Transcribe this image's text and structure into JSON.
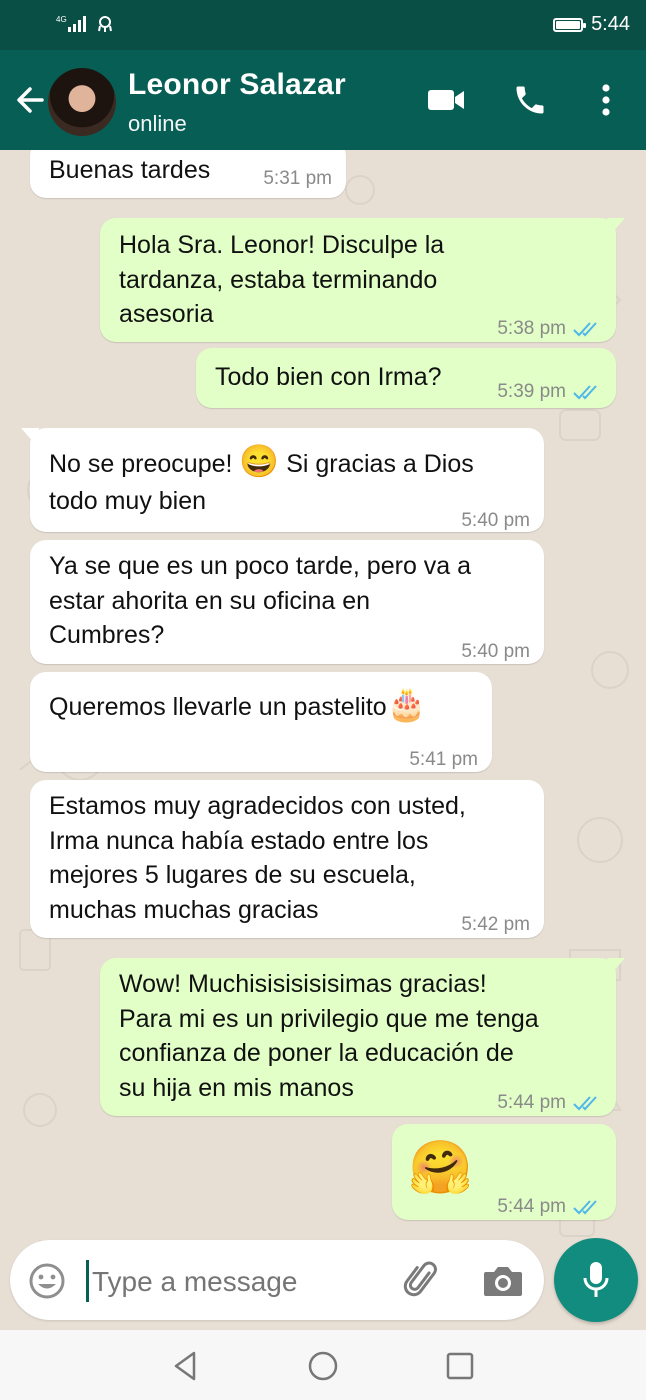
{
  "status_bar": {
    "network": "4G",
    "time": "5:44"
  },
  "header": {
    "contact_name": "Leonor Salazar",
    "status": "online"
  },
  "messages": [
    {
      "dir": "in",
      "lines": "Buenas tardes",
      "time": "5:31 pm"
    },
    {
      "dir": "out",
      "lines": "Hola Sra. Leonor! Disculpe la\ntardanza, estaba terminando\nasesoria",
      "time": "5:38 pm",
      "read": true
    },
    {
      "dir": "out",
      "lines": "Todo bien con Irma?",
      "time": "5:39 pm",
      "read": true
    },
    {
      "dir": "in",
      "lines_a": "No se preocupe! ",
      "emoji": "😄",
      "lines_b": " Si gracias a Dios",
      "lines_c": "todo muy bien",
      "time": "5:40 pm"
    },
    {
      "dir": "in",
      "lines": "Ya se que es un poco tarde, pero va a\nestar ahorita en su oficina en\nCumbres?",
      "time": "5:40 pm"
    },
    {
      "dir": "in",
      "lines": "Queremos llevarle un pastelito",
      "emoji": "🎂",
      "time": "5:41 pm"
    },
    {
      "dir": "in",
      "lines": "Estamos muy agradecidos con usted,\nIrma nunca había estado entre los\nmejores 5 lugares de su escuela,\nmuchas muchas gracias",
      "time": "5:42 pm"
    },
    {
      "dir": "out",
      "lines": "Wow! Muchisisisisisimas gracias!\nPara mi es un privilegio que me tenga\nconfianza de poner la educación de\nsu hija en mis manos",
      "time": "5:44 pm",
      "read": true
    },
    {
      "dir": "out",
      "emoji": "🤗",
      "time": "5:44 pm",
      "read": true
    }
  ],
  "composer": {
    "placeholder": "Type a message"
  },
  "colors": {
    "header": "#075e54",
    "status_bar": "#0a4f46",
    "outgoing": "#e1ffc7",
    "incoming": "#ffffff",
    "read_ticks": "#4fb6ec",
    "fab": "#128c7e"
  },
  "icons": [
    "back-arrow-icon",
    "video-call-icon",
    "phone-icon",
    "more-vert-icon",
    "emoji-icon",
    "attach-icon",
    "camera-icon",
    "mic-icon",
    "nav-back-icon",
    "nav-home-icon",
    "nav-recents-icon"
  ]
}
